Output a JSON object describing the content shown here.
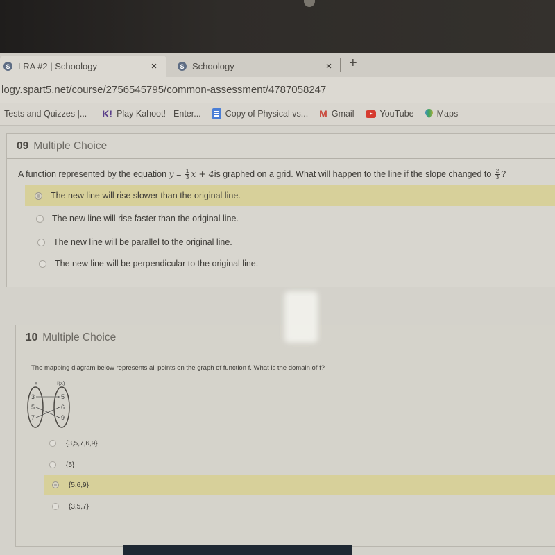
{
  "browser": {
    "tabs": [
      {
        "favicon": "S",
        "title": "LRA #2 | Schoology",
        "active": true
      },
      {
        "favicon": "S",
        "title": "Schoology",
        "active": false
      }
    ],
    "close_glyph": "×",
    "new_tab_glyph": "+",
    "url": "logy.spart5.net/course/2756545795/common-assessment/4787058247",
    "bookmarks": [
      {
        "label": "Tests and Quizzes |...",
        "icon": "none"
      },
      {
        "label": "Play Kahoot! - Enter...",
        "icon": "kahoot-icon",
        "glyph": "K!"
      },
      {
        "label": "Copy of Physical vs...",
        "icon": "google-docs-icon"
      },
      {
        "label": "Gmail",
        "icon": "gmail-icon",
        "glyph": "M"
      },
      {
        "label": "YouTube",
        "icon": "youtube-icon"
      },
      {
        "label": "Maps",
        "icon": "maps-icon"
      }
    ]
  },
  "questions": [
    {
      "number": "09",
      "type": "Multiple Choice",
      "stem": {
        "prefix": "A function represented by the equation ",
        "eq_lhs": "y",
        "eq_equals": " = ",
        "slope_num": "1",
        "slope_den": "3",
        "eq_rest": "x + 4",
        "middle": "is graphed on a grid. What will happen to the line if the slope changed to ",
        "new_slope_num": "2",
        "new_slope_den": "3",
        "suffix": "?"
      },
      "choices": [
        {
          "label": "The new line will rise slower than the original line.",
          "selected": true
        },
        {
          "label": "The new line will rise faster than the original line.",
          "selected": false
        },
        {
          "label": "The new line will be parallel to the original line.",
          "selected": false
        },
        {
          "label": "The new line will be perpendicular to the original line.",
          "selected": false
        }
      ]
    },
    {
      "number": "10",
      "type": "Multiple Choice",
      "stem": "The mapping diagram below represents all points on the graph of function f. What is the domain of f?",
      "diagram": {
        "x_label": "x",
        "fx_label": "f(x)",
        "domain": [
          "3",
          "5",
          "7"
        ],
        "range": [
          "5",
          "6",
          "9"
        ],
        "mappings": [
          [
            "3",
            "5"
          ],
          [
            "5",
            "9"
          ],
          [
            "7",
            "6"
          ]
        ]
      },
      "choices": [
        {
          "label": "{3,5,7,6,9}",
          "selected": false
        },
        {
          "label": "{5}",
          "selected": false
        },
        {
          "label": "{5,6,9}",
          "selected": true
        },
        {
          "label": "{3,5,7}",
          "selected": false
        }
      ]
    }
  ],
  "colors": {
    "selected_highlight": "#d7d09a",
    "page_bg": "#d4d2cb"
  }
}
